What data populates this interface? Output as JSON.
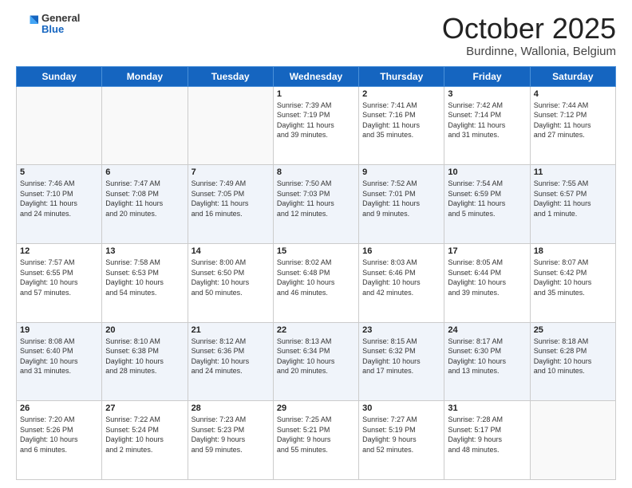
{
  "header": {
    "logo_general": "General",
    "logo_blue": "Blue",
    "title": "October 2025",
    "location": "Burdinne, Wallonia, Belgium"
  },
  "days_of_week": [
    "Sunday",
    "Monday",
    "Tuesday",
    "Wednesday",
    "Thursday",
    "Friday",
    "Saturday"
  ],
  "weeks": [
    [
      {
        "day": "",
        "info": ""
      },
      {
        "day": "",
        "info": ""
      },
      {
        "day": "",
        "info": ""
      },
      {
        "day": "1",
        "info": "Sunrise: 7:39 AM\nSunset: 7:19 PM\nDaylight: 11 hours\nand 39 minutes."
      },
      {
        "day": "2",
        "info": "Sunrise: 7:41 AM\nSunset: 7:16 PM\nDaylight: 11 hours\nand 35 minutes."
      },
      {
        "day": "3",
        "info": "Sunrise: 7:42 AM\nSunset: 7:14 PM\nDaylight: 11 hours\nand 31 minutes."
      },
      {
        "day": "4",
        "info": "Sunrise: 7:44 AM\nSunset: 7:12 PM\nDaylight: 11 hours\nand 27 minutes."
      }
    ],
    [
      {
        "day": "5",
        "info": "Sunrise: 7:46 AM\nSunset: 7:10 PM\nDaylight: 11 hours\nand 24 minutes."
      },
      {
        "day": "6",
        "info": "Sunrise: 7:47 AM\nSunset: 7:08 PM\nDaylight: 11 hours\nand 20 minutes."
      },
      {
        "day": "7",
        "info": "Sunrise: 7:49 AM\nSunset: 7:05 PM\nDaylight: 11 hours\nand 16 minutes."
      },
      {
        "day": "8",
        "info": "Sunrise: 7:50 AM\nSunset: 7:03 PM\nDaylight: 11 hours\nand 12 minutes."
      },
      {
        "day": "9",
        "info": "Sunrise: 7:52 AM\nSunset: 7:01 PM\nDaylight: 11 hours\nand 9 minutes."
      },
      {
        "day": "10",
        "info": "Sunrise: 7:54 AM\nSunset: 6:59 PM\nDaylight: 11 hours\nand 5 minutes."
      },
      {
        "day": "11",
        "info": "Sunrise: 7:55 AM\nSunset: 6:57 PM\nDaylight: 11 hours\nand 1 minute."
      }
    ],
    [
      {
        "day": "12",
        "info": "Sunrise: 7:57 AM\nSunset: 6:55 PM\nDaylight: 10 hours\nand 57 minutes."
      },
      {
        "day": "13",
        "info": "Sunrise: 7:58 AM\nSunset: 6:53 PM\nDaylight: 10 hours\nand 54 minutes."
      },
      {
        "day": "14",
        "info": "Sunrise: 8:00 AM\nSunset: 6:50 PM\nDaylight: 10 hours\nand 50 minutes."
      },
      {
        "day": "15",
        "info": "Sunrise: 8:02 AM\nSunset: 6:48 PM\nDaylight: 10 hours\nand 46 minutes."
      },
      {
        "day": "16",
        "info": "Sunrise: 8:03 AM\nSunset: 6:46 PM\nDaylight: 10 hours\nand 42 minutes."
      },
      {
        "day": "17",
        "info": "Sunrise: 8:05 AM\nSunset: 6:44 PM\nDaylight: 10 hours\nand 39 minutes."
      },
      {
        "day": "18",
        "info": "Sunrise: 8:07 AM\nSunset: 6:42 PM\nDaylight: 10 hours\nand 35 minutes."
      }
    ],
    [
      {
        "day": "19",
        "info": "Sunrise: 8:08 AM\nSunset: 6:40 PM\nDaylight: 10 hours\nand 31 minutes."
      },
      {
        "day": "20",
        "info": "Sunrise: 8:10 AM\nSunset: 6:38 PM\nDaylight: 10 hours\nand 28 minutes."
      },
      {
        "day": "21",
        "info": "Sunrise: 8:12 AM\nSunset: 6:36 PM\nDaylight: 10 hours\nand 24 minutes."
      },
      {
        "day": "22",
        "info": "Sunrise: 8:13 AM\nSunset: 6:34 PM\nDaylight: 10 hours\nand 20 minutes."
      },
      {
        "day": "23",
        "info": "Sunrise: 8:15 AM\nSunset: 6:32 PM\nDaylight: 10 hours\nand 17 minutes."
      },
      {
        "day": "24",
        "info": "Sunrise: 8:17 AM\nSunset: 6:30 PM\nDaylight: 10 hours\nand 13 minutes."
      },
      {
        "day": "25",
        "info": "Sunrise: 8:18 AM\nSunset: 6:28 PM\nDaylight: 10 hours\nand 10 minutes."
      }
    ],
    [
      {
        "day": "26",
        "info": "Sunrise: 7:20 AM\nSunset: 5:26 PM\nDaylight: 10 hours\nand 6 minutes."
      },
      {
        "day": "27",
        "info": "Sunrise: 7:22 AM\nSunset: 5:24 PM\nDaylight: 10 hours\nand 2 minutes."
      },
      {
        "day": "28",
        "info": "Sunrise: 7:23 AM\nSunset: 5:23 PM\nDaylight: 9 hours\nand 59 minutes."
      },
      {
        "day": "29",
        "info": "Sunrise: 7:25 AM\nSunset: 5:21 PM\nDaylight: 9 hours\nand 55 minutes."
      },
      {
        "day": "30",
        "info": "Sunrise: 7:27 AM\nSunset: 5:19 PM\nDaylight: 9 hours\nand 52 minutes."
      },
      {
        "day": "31",
        "info": "Sunrise: 7:28 AM\nSunset: 5:17 PM\nDaylight: 9 hours\nand 48 minutes."
      },
      {
        "day": "",
        "info": ""
      }
    ]
  ]
}
